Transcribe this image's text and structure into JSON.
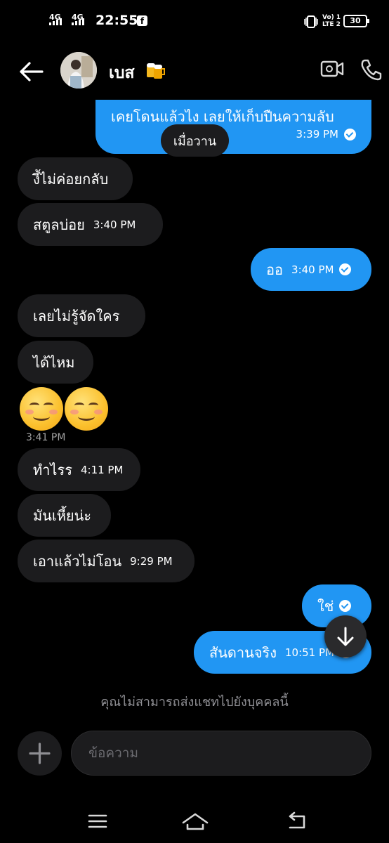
{
  "status_bar": {
    "net1": "4G",
    "net2": "4G",
    "time": "22:55",
    "fb": "f",
    "volte": "Vo) 1",
    "lte": "LTE 2",
    "battery": "30"
  },
  "header": {
    "contact_name": "เบส",
    "name_emoji_icon": "beer-mugs-icon",
    "video_call_icon": "video-camera-icon",
    "voice_call_icon": "phone-icon"
  },
  "date_divider": "เมื่อวาน",
  "messages": [
    {
      "text": "เคยโดนแล้วไง เลยให้เก็บปืนความลับ",
      "time": "3:39 PM",
      "dir": "out"
    },
    {
      "text": "งี้ไม่ค่อยกลับ",
      "time": "",
      "dir": "in"
    },
    {
      "text": "สตูลบ่อย",
      "time": "3:40 PM",
      "dir": "in"
    },
    {
      "text": "ออ",
      "time": "3:40 PM",
      "dir": "out"
    },
    {
      "text": "เลยไม่รู้จัดใคร",
      "time": "",
      "dir": "in"
    },
    {
      "text": "ได้ไหม",
      "time": "",
      "dir": "in"
    },
    {
      "text": "ทำไรร",
      "time": "4:11 PM",
      "dir": "in"
    },
    {
      "text": "มันเหี้ยน่ะ",
      "time": "",
      "dir": "in"
    },
    {
      "text": "เอาแล้วไม่โอน",
      "time": "9:29 PM",
      "dir": "in"
    },
    {
      "text": "ใช่",
      "time": "",
      "dir": "out"
    },
    {
      "text": "สันดานจริง",
      "time": "10:51 PM",
      "dir": "out"
    }
  ],
  "emoji_message": {
    "icons": [
      "smiling-face-icon",
      "smiling-face-icon"
    ],
    "time": "3:41 PM"
  },
  "notice": "คุณไม่สามารถส่งแชทไปยังบุคคลนี้",
  "composer": {
    "placeholder": "ข้อความ"
  },
  "colors": {
    "outgoing": "#2196f3",
    "incoming": "#1c1c1e",
    "background": "#000000"
  }
}
